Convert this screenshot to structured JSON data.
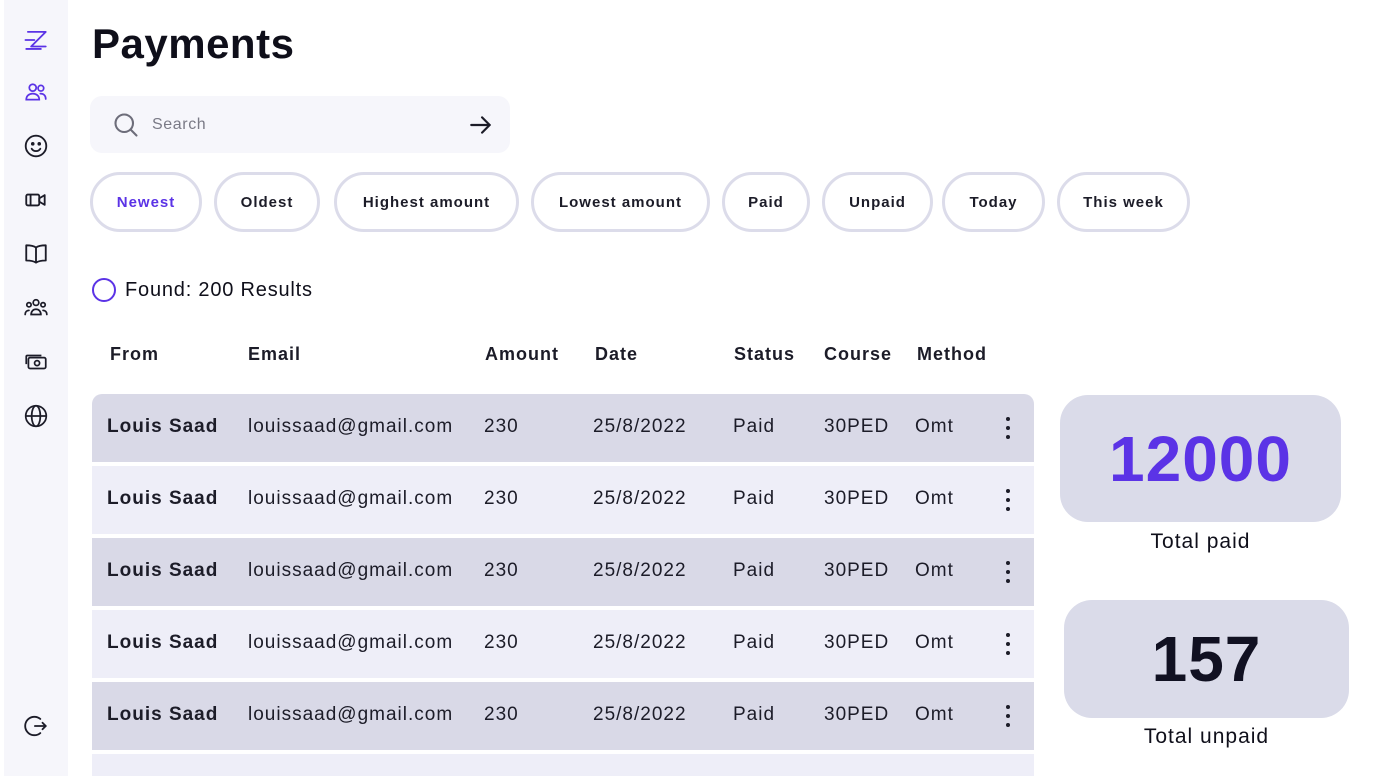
{
  "sidebar": {
    "items": [
      {
        "icon": "logo-icon"
      },
      {
        "icon": "users-icon"
      },
      {
        "icon": "smile-icon"
      },
      {
        "icon": "video-icon"
      },
      {
        "icon": "book-icon"
      },
      {
        "icon": "group-icon"
      },
      {
        "icon": "payments-icon"
      },
      {
        "icon": "globe-icon"
      },
      {
        "icon": "logout-icon"
      }
    ],
    "accent": "#5b33e6"
  },
  "page": {
    "title": "Payments"
  },
  "search": {
    "placeholder": "Search",
    "value": ""
  },
  "filters": [
    {
      "label": "Newest",
      "active": true
    },
    {
      "label": "Oldest",
      "active": false
    },
    {
      "label": "Highest amount",
      "active": false
    },
    {
      "label": "Lowest amount",
      "active": false
    },
    {
      "label": "Paid",
      "active": false
    },
    {
      "label": "Unpaid",
      "active": false
    },
    {
      "label": "Today",
      "active": false
    },
    {
      "label": "This week",
      "active": false
    }
  ],
  "found": {
    "text": "Found: 200 Results"
  },
  "table": {
    "headers": [
      "From",
      "Email",
      "Amount",
      "Date",
      "Status",
      "Course",
      "Method"
    ],
    "rows": [
      {
        "from": "Louis Saad",
        "email": "louissaad@gmail.com",
        "amount": "230",
        "date": "25/8/2022",
        "status": "Paid",
        "course": "30PED",
        "method": "Omt"
      },
      {
        "from": "Louis Saad",
        "email": "louissaad@gmail.com",
        "amount": "230",
        "date": "25/8/2022",
        "status": "Paid",
        "course": "30PED",
        "method": "Omt"
      },
      {
        "from": "Louis Saad",
        "email": "louissaad@gmail.com",
        "amount": "230",
        "date": "25/8/2022",
        "status": "Paid",
        "course": "30PED",
        "method": "Omt"
      },
      {
        "from": "Louis Saad",
        "email": "louissaad@gmail.com",
        "amount": "230",
        "date": "25/8/2022",
        "status": "Paid",
        "course": "30PED",
        "method": "Omt"
      },
      {
        "from": "Louis Saad",
        "email": "louissaad@gmail.com",
        "amount": "230",
        "date": "25/8/2022",
        "status": "Paid",
        "course": "30PED",
        "method": "Omt"
      }
    ]
  },
  "stats": {
    "paid": {
      "value": "12000",
      "label": "Total paid",
      "color": "#5b33e6"
    },
    "unpaid": {
      "value": "157",
      "label": "Total unpaid",
      "color": "#111122"
    }
  }
}
